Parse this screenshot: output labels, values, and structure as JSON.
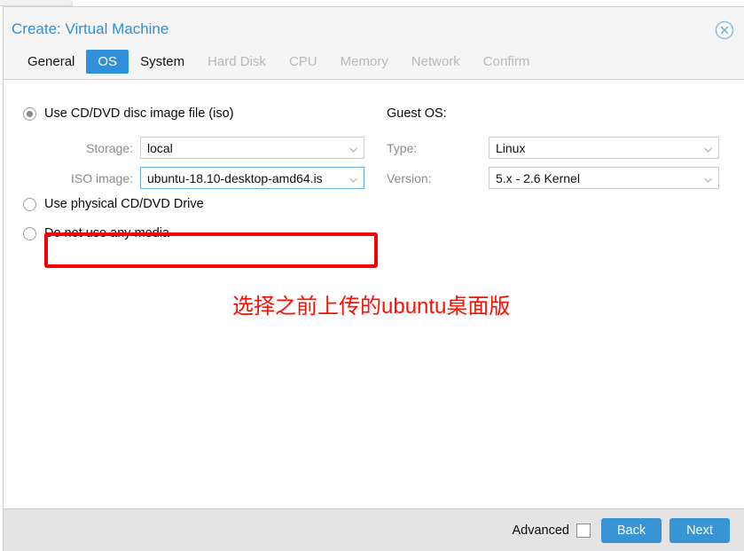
{
  "window": {
    "title": "Create: Virtual Machine",
    "close_icon": "close-circle-icon"
  },
  "tabs": [
    {
      "label": "General",
      "state": "enabled"
    },
    {
      "label": "OS",
      "state": "active"
    },
    {
      "label": "System",
      "state": "enabled"
    },
    {
      "label": "Hard Disk",
      "state": "disabled"
    },
    {
      "label": "CPU",
      "state": "disabled"
    },
    {
      "label": "Memory",
      "state": "disabled"
    },
    {
      "label": "Network",
      "state": "disabled"
    },
    {
      "label": "Confirm",
      "state": "disabled"
    }
  ],
  "media": {
    "options": [
      {
        "label": "Use CD/DVD disc image file (iso)",
        "selected": true
      },
      {
        "label": "Use physical CD/DVD Drive",
        "selected": false
      },
      {
        "label": "Do not use any media",
        "selected": false
      }
    ],
    "storage": {
      "label": "Storage:",
      "value": "local",
      "chevron": "chevron-down-icon"
    },
    "iso_image": {
      "label": "ISO image:",
      "value": "ubuntu-18.10-desktop-amd64.is",
      "chevron": "chevron-down-icon"
    }
  },
  "guest_os": {
    "title": "Guest OS:",
    "type": {
      "label": "Type:",
      "value": "Linux",
      "chevron": "chevron-down-icon"
    },
    "version": {
      "label": "Version:",
      "value": "5.x - 2.6 Kernel",
      "chevron": "chevron-down-icon"
    }
  },
  "annotation": {
    "text": "选择之前上传的ubuntu桌面版",
    "color": "#ff0d00",
    "box_color": "#f40000"
  },
  "footer": {
    "advanced_label": "Advanced",
    "advanced_checked": false,
    "back_label": "Back",
    "next_label": "Next"
  },
  "colors": {
    "accent": "#3895d3",
    "title": "#2f8fd8",
    "header_bg": "#f5f5f5",
    "footer_bg": "#e4e4e4"
  }
}
